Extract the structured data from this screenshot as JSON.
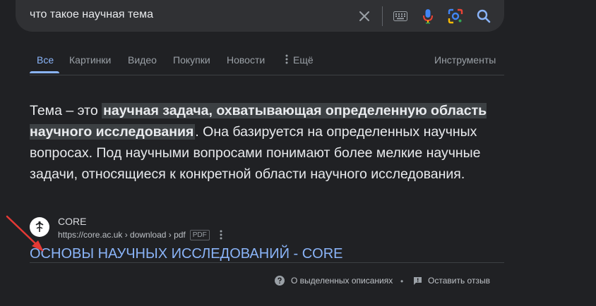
{
  "search": {
    "query": "что такое научная тема",
    "icons": [
      "close-icon",
      "keyboard-icon",
      "mic-icon",
      "lens-icon",
      "search-icon"
    ]
  },
  "tabs": [
    {
      "label": "Все",
      "active": true
    },
    {
      "label": "Картинки"
    },
    {
      "label": "Видео"
    },
    {
      "label": "Покупки"
    },
    {
      "label": "Новости"
    },
    {
      "label": "Ещё"
    }
  ],
  "tools_label": "Инструменты",
  "snippet": {
    "before": "Тема – это ",
    "highlight": "научная задача, охватывающая определенную область научного исследования",
    "after": ". Она базируется на определенных научных вопросах. Под научными вопросами понимают более мелкие научные задачи, относящиеся к конкретной области научного исследования."
  },
  "source": {
    "name": "CORE",
    "url": "https://core.ac.uk › download › pdf",
    "badge": "PDF"
  },
  "result_title": "ОСНОВЫ НАУЧНЫХ ИССЛЕДОВАНИЙ - CORE",
  "footer": {
    "about": "О выделенных описаниях",
    "separator": "•",
    "feedback": "Оставить отзыв"
  },
  "colors": {
    "background": "#202124",
    "link": "#8ab4f8",
    "annotation_arrow": "#e53935"
  }
}
